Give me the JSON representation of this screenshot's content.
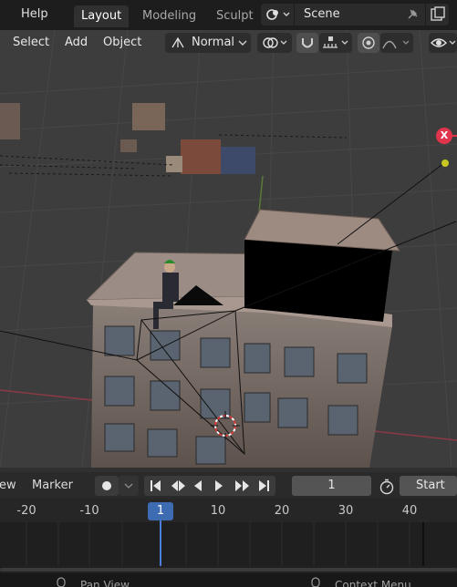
{
  "topbar": {
    "menus": [
      "Help"
    ],
    "workspaces": [
      {
        "label": "Layout",
        "active": true
      },
      {
        "label": "Modeling",
        "active": false
      },
      {
        "label": "Sculpt",
        "active": false
      }
    ],
    "scene_name": "Scene"
  },
  "viewport_header": {
    "menus": [
      "Select",
      "Add",
      "Object"
    ],
    "transform_orientation": "Normal"
  },
  "gizmo": {
    "x_axis_label": "X",
    "x_color": "#e0344c",
    "y_color": "#c8c820"
  },
  "timeline": {
    "menus": [
      "ew",
      "Marker"
    ],
    "current_frame": "1",
    "start_label": "Start",
    "ticks": [
      "-20",
      "-10",
      "1",
      "10",
      "20",
      "30",
      "40"
    ],
    "playhead_color": "#4a7ed8"
  },
  "statusbar": {
    "left_hint": "Pan View",
    "right_hint": "Context Menu"
  }
}
